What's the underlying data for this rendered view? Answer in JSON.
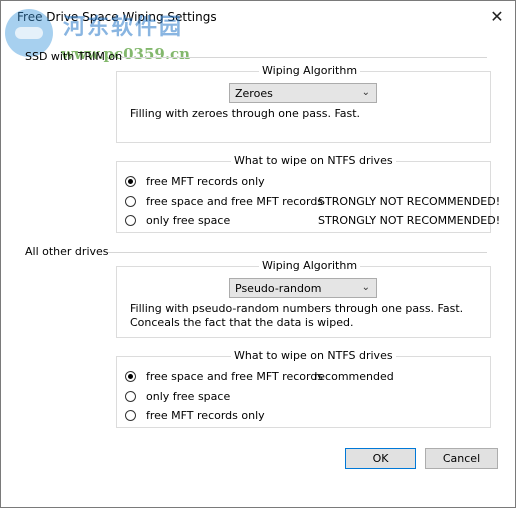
{
  "window": {
    "title": "Free Drive Space Wiping Settings"
  },
  "watermark": {
    "brand": "河东软件园",
    "url": "www.pc0359.cn"
  },
  "ssd": {
    "section_label": "SSD with TRIM on",
    "algorithm": {
      "title": "Wiping  Algorithm",
      "selected": "Zeroes",
      "description_lines": [
        "Filling with zeroes through one pass. Fast."
      ]
    },
    "ntfs": {
      "title": "What to wipe on NTFS drives",
      "options": [
        {
          "label": "free MFT records only",
          "note": "",
          "checked": true
        },
        {
          "label": "free space and free MFT records",
          "note": "STRONGLY NOT RECOMMENDED!",
          "checked": false
        },
        {
          "label": "only free space",
          "note": "STRONGLY NOT RECOMMENDED!",
          "checked": false
        }
      ]
    }
  },
  "other": {
    "section_label": "All other drives",
    "algorithm": {
      "title": "Wiping  Algorithm",
      "selected": "Pseudo-random",
      "description_lines": [
        "Filling with pseudo-random numbers through one pass. Fast.",
        "Conceals the fact that the data is wiped."
      ]
    },
    "ntfs": {
      "title": "What to wipe on NTFS drives",
      "options": [
        {
          "label": "free space and free MFT records",
          "note": "recommended",
          "checked": true
        },
        {
          "label": "only free space",
          "note": "",
          "checked": false
        },
        {
          "label": "free MFT records only",
          "note": "",
          "checked": false
        }
      ]
    }
  },
  "buttons": {
    "ok": "OK",
    "cancel": "Cancel"
  }
}
